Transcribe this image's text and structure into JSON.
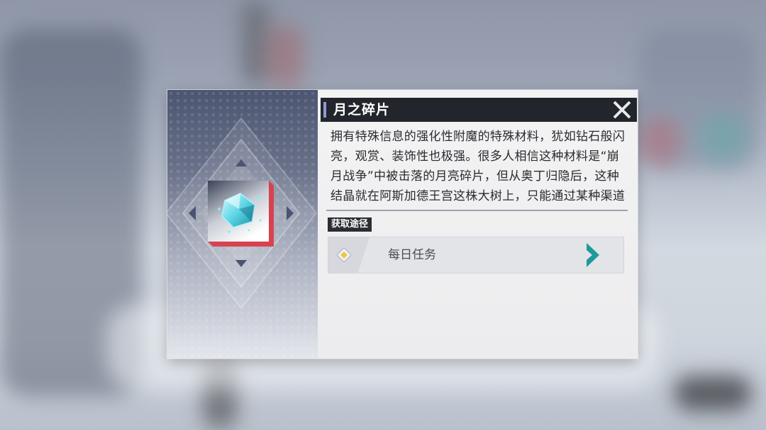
{
  "item": {
    "name": "月之碎片",
    "description": "拥有特殊信息的强化性附魔的特殊材料，犹如钻石般闪亮，观赏、装饰性也极强。很多人相信这种材料是“崩月战争”中被击落的月亮碎片，但从奥丁归隐后，这种结晶就在阿斯加德王宫这株大树上，只能通过某种渠道获得，有"
  },
  "source_section": {
    "label": "获取途径",
    "entries": [
      {
        "label": "每日任务"
      }
    ]
  },
  "icons": {
    "close": "close-x-icon",
    "item": "moon-shard-crystal-icon",
    "entry_marker": "diamond-icon",
    "entry_go": "chevron-right-icon"
  },
  "colors": {
    "title_bar": "#23252c",
    "accent_teal": "#1f9a9a",
    "rarity_red": "#d8424f",
    "crystal": "#5fd6e6"
  }
}
